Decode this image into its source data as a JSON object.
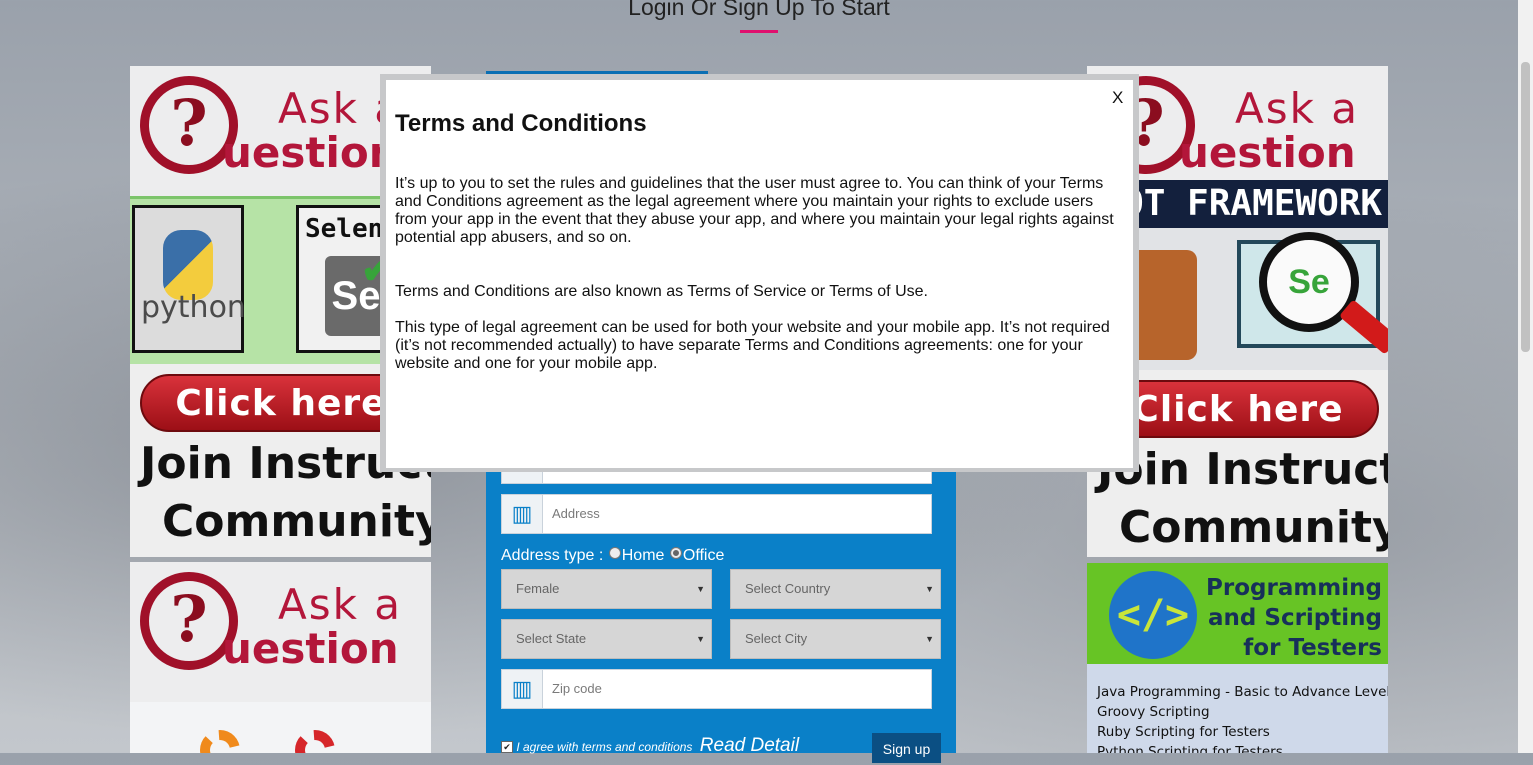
{
  "page": {
    "title": "Login Or Sign Up To Start",
    "accent": "#e0106e"
  },
  "ads": {
    "ask_line1": "Ask a",
    "ask_line2": "uestion",
    "ask_mark": "?",
    "python_label": "python",
    "selenium_label": "Selenium",
    "se_label": "Se",
    "robot_banner": "ROBOT FRAMEWORK",
    "click_here": "Click here",
    "join_line1": "Join Instructor",
    "join_line2": "Community",
    "programming_title": "Programming and Scripting for Testers",
    "code_glyph": "</>",
    "courses": [
      "Java Programming - Basic to Advance Level",
      "Groovy Scripting",
      "Ruby Scripting for Testers",
      "Python Scripting for Testers"
    ]
  },
  "form": {
    "address_placeholder": "Address",
    "address_type_label": "Address type :",
    "radio_home": "Home",
    "radio_office": "Office",
    "address_type_selected": "Office",
    "gender_value": "Female",
    "country_placeholder": "Select Country",
    "state_placeholder": "Select State",
    "city_placeholder": "Select City",
    "zip_placeholder": "Zip code",
    "agree_text": "I agree with terms and conditions",
    "agree_checked": true,
    "read_detail": "Read Detail",
    "signup_label": "Sign up",
    "panel_color": "#0a80c8"
  },
  "modal": {
    "close_label": "X",
    "title": "Terms and Conditions",
    "paragraph1": "It’s up to you to set the rules and guidelines that the user must agree to. You can think of your Terms and Conditions agreement as the legal agreement where you maintain your rights to exclude users from your app in the event that they abuse your app, and where you maintain your legal rights against potential app abusers, and so on.",
    "paragraph2": "Terms and Conditions are also known as Terms of Service or Terms of Use.",
    "paragraph3": "This type of legal agreement can be used for both your website and your mobile app. It’s not required (it’s not recommended actually) to have separate Terms and Conditions agreements: one for your website and one for your mobile app."
  }
}
